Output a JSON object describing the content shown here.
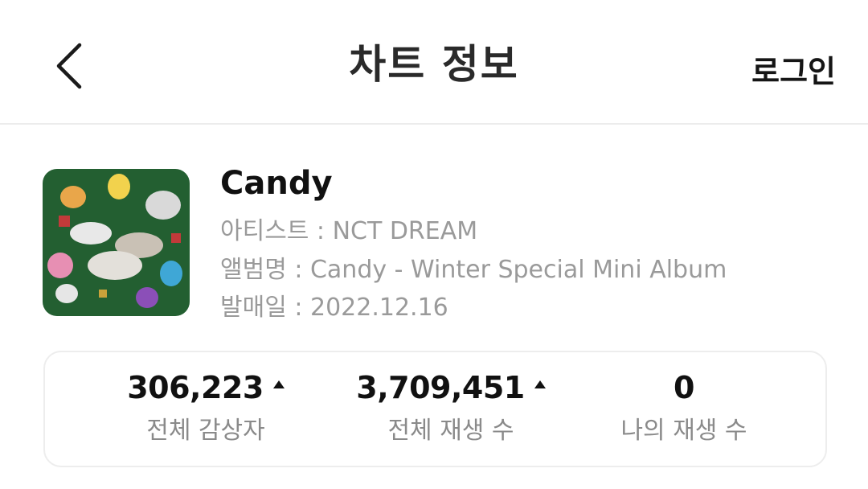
{
  "header": {
    "title": "차트 정보",
    "login_label": "로그인",
    "back_icon": "chevron-left-icon"
  },
  "song": {
    "title": "Candy",
    "artist_line": "아티스트 : NCT DREAM",
    "album_line": "앨범명 : Candy - Winter Special Mini Album",
    "release_line": "발매일 : 2022.12.16"
  },
  "stats": [
    {
      "value": "306,223",
      "label": "전체 감상자",
      "trend": "up"
    },
    {
      "value": "3,709,451",
      "label": "전체 재생 수",
      "trend": "up"
    },
    {
      "value": "0",
      "label": "나의 재생 수",
      "trend": "none"
    }
  ],
  "colors": {
    "text_primary": "#111111",
    "text_secondary": "#9a9a9a",
    "divider": "#ececec",
    "album_bg": "#1f5a2e"
  }
}
